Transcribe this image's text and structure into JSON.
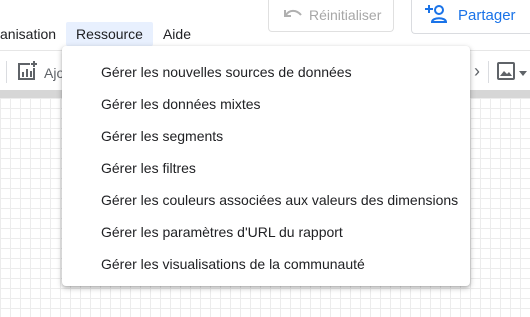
{
  "menubar": {
    "items": [
      {
        "label": "anisation"
      },
      {
        "label": "Ressource"
      },
      {
        "label": "Aide"
      }
    ]
  },
  "header": {
    "reset_label": "Réinitialiser",
    "share_label": "Partager"
  },
  "toolbar": {
    "add_label": "Ajo"
  },
  "dropdown": {
    "items": [
      {
        "label": "Gérer les nouvelles sources de données"
      },
      {
        "label": "Gérer les données mixtes"
      },
      {
        "label": "Gérer les segments"
      },
      {
        "label": "Gérer les filtres"
      },
      {
        "label": "Gérer les couleurs associées aux valeurs des dimensions"
      },
      {
        "label": "Gérer les paramètres d'URL du rapport"
      },
      {
        "label": "Gérer les visualisations de la communauté"
      }
    ]
  },
  "colors": {
    "accent": "#1a73e8",
    "menu_active_bg": "#e8f0fe",
    "disabled_text": "#a7a7a7"
  }
}
